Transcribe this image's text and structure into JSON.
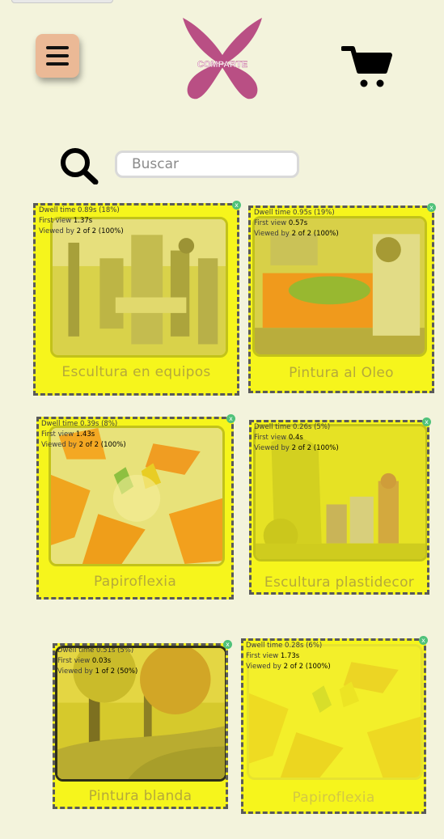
{
  "header": {
    "logo_text": "COMPARTE",
    "menu_icon": "hamburger-icon",
    "cart_icon": "shopping-cart-icon"
  },
  "search": {
    "placeholder": "Buscar",
    "icon": "search-icon"
  },
  "cards": [
    {
      "title": "Escultura en equipos",
      "dwell_label": "Dwell time 0.89s (18%)",
      "first_view_prefix": "First view ",
      "first_view_value": "1.37s",
      "viewed_prefix": "Viewed by ",
      "viewed_value": "2 of 2 (100%)"
    },
    {
      "title": "Pintura al Oleo",
      "dwell_label": "Dwell time 0.95s (19%)",
      "first_view_prefix": "First view ",
      "first_view_value": "0.57s",
      "viewed_prefix": "Viewed by ",
      "viewed_value": "2 of 2 (100%)"
    },
    {
      "title": "Papiroflexia",
      "dwell_label": "Dwell time 0.39s (8%)",
      "first_view_prefix": "First view ",
      "first_view_value": "1.43s",
      "viewed_prefix": "Viewed by ",
      "viewed_value": "2 of 2 (100%)"
    },
    {
      "title": "Escultura plastidecor",
      "dwell_label": "Dwell time 0.26s (5%)",
      "first_view_prefix": "First view ",
      "first_view_value": "0.4s",
      "viewed_prefix": "Viewed by ",
      "viewed_value": "2 of 2 (100%)"
    },
    {
      "title": "Pintura blanda",
      "dwell_label": "Dwell time 0.51s (5%)",
      "first_view_prefix": "First view ",
      "first_view_value": "0.03s",
      "viewed_prefix": "Viewed by ",
      "viewed_value": "1 of 2 (50%)"
    },
    {
      "title": "Papiroflexia",
      "dwell_label": "Dwell time 0.28s (6%)",
      "first_view_prefix": "First view ",
      "first_view_value": "1.73s",
      "viewed_prefix": "Viewed by ",
      "viewed_value": "2 of 2 (100%)"
    }
  ],
  "close_glyph": "x",
  "colors": {
    "background": "#f3f3dc",
    "heatmap_overlay": "#f6f51c",
    "menu_button": "#ebb996",
    "logo": "#b94f84",
    "close_dot": "#4fc27a"
  }
}
